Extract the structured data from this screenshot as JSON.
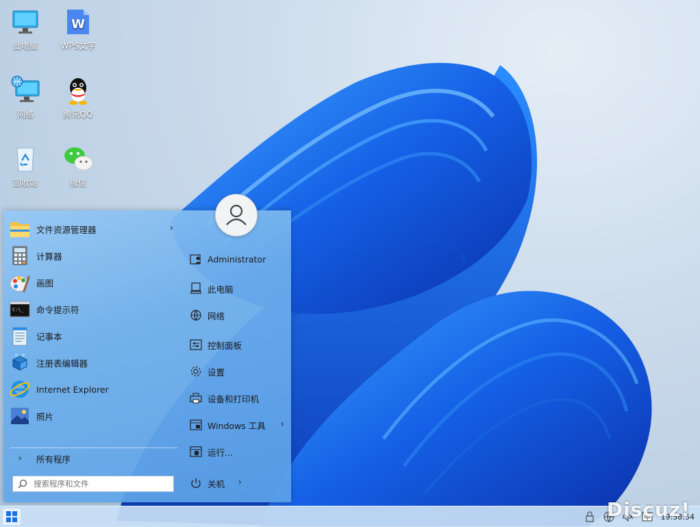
{
  "desktop": {
    "icons": [
      {
        "label": "此电脑",
        "icon": "this-pc-icon"
      },
      {
        "label": "WPS文字",
        "icon": "wps-writer-icon"
      },
      {
        "label": "网络",
        "icon": "network-icon"
      },
      {
        "label": "腾讯QQ",
        "icon": "qq-icon"
      },
      {
        "label": "回收站",
        "icon": "recycle-bin-icon"
      },
      {
        "label": "微信",
        "icon": "wechat-icon"
      }
    ]
  },
  "start_menu": {
    "apps": [
      {
        "label": "文件资源管理器",
        "icon": "file-explorer-icon",
        "has_submenu": true
      },
      {
        "label": "计算器",
        "icon": "calculator-icon"
      },
      {
        "label": "画图",
        "icon": "paint-icon"
      },
      {
        "label": "命令提示符",
        "icon": "command-prompt-icon"
      },
      {
        "label": "记事本",
        "icon": "notepad-icon"
      },
      {
        "label": "注册表编辑器",
        "icon": "registry-editor-icon"
      },
      {
        "label": "Internet Explorer",
        "icon": "internet-explorer-icon"
      },
      {
        "label": "照片",
        "icon": "photos-icon"
      }
    ],
    "all_programs": "所有程序",
    "search": {
      "placeholder": "搜索程序和文件"
    },
    "places": [
      {
        "label": "Administrator",
        "icon": "user-folder-icon"
      },
      {
        "label": "此电脑",
        "icon": "computer-icon"
      },
      {
        "label": "网络",
        "icon": "network-globe-icon"
      },
      {
        "label": "控制面板",
        "icon": "control-panel-icon"
      },
      {
        "label": "设置",
        "icon": "settings-gear-icon"
      },
      {
        "label": "设备和打印机",
        "icon": "printer-icon"
      },
      {
        "label": "Windows 工具",
        "icon": "windows-tools-icon",
        "has_submenu": true
      },
      {
        "label": "运行...",
        "icon": "run-icon"
      }
    ],
    "shutdown": "关机",
    "avatar_icon": "user-avatar-icon"
  },
  "taskbar": {
    "start_icon": "windows-logo-icon",
    "tray_icons": [
      "security-icon",
      "network-tray-icon",
      "volume-muted-icon",
      "input-method-icon"
    ],
    "clock": "19:58:54"
  },
  "watermark": "Discuz!",
  "colors": {
    "accent": "#1b6fe0",
    "menu_bg": "#6fb0eb",
    "taskbar_bg": "#c8def4"
  }
}
